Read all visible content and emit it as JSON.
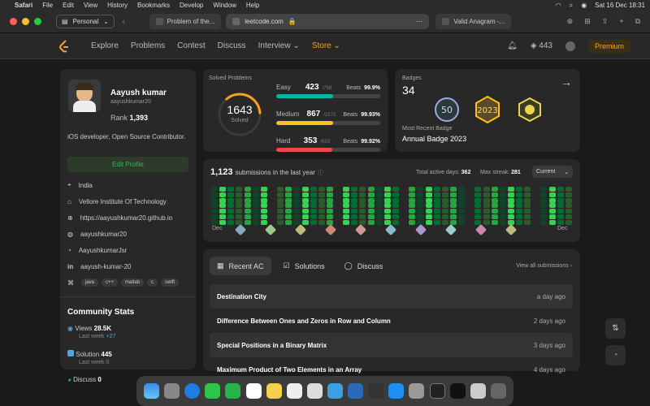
{
  "menubar": {
    "apple": "",
    "items": [
      "Safari",
      "File",
      "Edit",
      "View",
      "History",
      "Bookmarks",
      "Develop",
      "Window",
      "Help"
    ],
    "clock": "Sat 16 Dec  18:31"
  },
  "browser": {
    "profile": "Personal",
    "tab1": "Problem of the...",
    "url": "leetcode.com",
    "tab2": "Valid Anagram -..."
  },
  "nav": {
    "items": [
      "Explore",
      "Problems",
      "Contest",
      "Discuss",
      "Interview ⌄",
      "Store ⌄"
    ],
    "coins": "443",
    "premium": "Premium"
  },
  "profile": {
    "name": "Aayush kumar",
    "username": "aayushkumar20",
    "rank_label": "Rank",
    "rank": "1,393",
    "bio": "iOS developer, Open Source Contributor.",
    "edit": "Edit Profile",
    "location": "India",
    "school": "Vellore Institute Of Technology",
    "site": "https://aayushkumar20.github.io",
    "github": "aayushkumar20",
    "twitter": "AayushkumarJsr",
    "linkedin": "aayush-kumar-20",
    "tags": [
      "java",
      "c++",
      "matlab",
      "c",
      "swift"
    ]
  },
  "community": {
    "title": "Community Stats",
    "views_label": "Views",
    "views": "28.5K",
    "views_sub": "Last week",
    "views_delta": "+27",
    "solution_label": "Solution",
    "solution": "445",
    "solution_sub": "Last week",
    "solution_delta": "0",
    "discuss_label": "Discuss",
    "discuss": "0"
  },
  "solved": {
    "title": "Solved Problems",
    "total": "1643",
    "total_label": "Solved",
    "rows": [
      {
        "label": "Easy",
        "count": "423",
        "total": "/768",
        "beats_label": "Beats",
        "beats": "99.9%",
        "color": "#00b8a3",
        "fill": 0.55
      },
      {
        "label": "Medium",
        "count": "867",
        "total": "/1573",
        "beats_label": "Beats",
        "beats": "99.93%",
        "color": "#ffc01e",
        "fill": 0.55
      },
      {
        "label": "Hard",
        "count": "353",
        "total": "/653",
        "beats_label": "Beats",
        "beats": "99.92%",
        "color": "#ef4743",
        "fill": 0.54
      }
    ]
  },
  "badges": {
    "title": "Badges",
    "count": "34",
    "recent_label": "Most Recent Badge",
    "recent": "Annual Badge 2023"
  },
  "submissions": {
    "count": "1,123",
    "text": "submissions in the last year",
    "active_label": "Total active days:",
    "active": "362",
    "streak_label": "Max streak:",
    "streak": "281",
    "select": "Current",
    "month_start": "Dec",
    "month_end": "Dec"
  },
  "recent": {
    "tabs": [
      "Recent AC",
      "Solutions",
      "Discuss"
    ],
    "view_all": "View all submissions",
    "items": [
      {
        "title": "Destination City",
        "time": "a day ago"
      },
      {
        "title": "Difference Between Ones and Zeros in Row and Column",
        "time": "2 days ago"
      },
      {
        "title": "Special Positions in a Binary Matrix",
        "time": "3 days ago"
      },
      {
        "title": "Maximum Product of Two Elements in an Array",
        "time": "4 days ago"
      }
    ]
  }
}
